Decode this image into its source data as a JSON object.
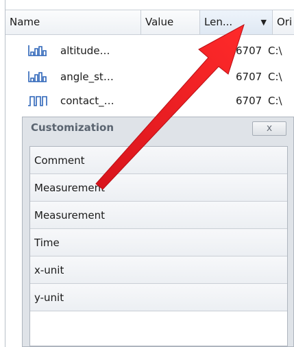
{
  "columns": {
    "name": "Name",
    "value": "Value",
    "length": "Len...",
    "origin": "Ori"
  },
  "rows": [
    {
      "icon": "step-signal-icon",
      "name": "altitude…",
      "length": "6707",
      "origin": "C:\\"
    },
    {
      "icon": "step-signal-icon",
      "name": "angle_st…",
      "length": "6707",
      "origin": "C:\\"
    },
    {
      "icon": "pulse-signal-icon",
      "name": "contact_…",
      "length": "6707",
      "origin": "C:\\"
    }
  ],
  "customization": {
    "title": "Customization",
    "close_label": "x",
    "items": [
      "Comment",
      "Measurement",
      "Measurement",
      "Time",
      "x-unit",
      "y-unit"
    ]
  },
  "colors": {
    "annotation_arrow": "#ee1c24",
    "icon_blue": "#2c64b8"
  }
}
